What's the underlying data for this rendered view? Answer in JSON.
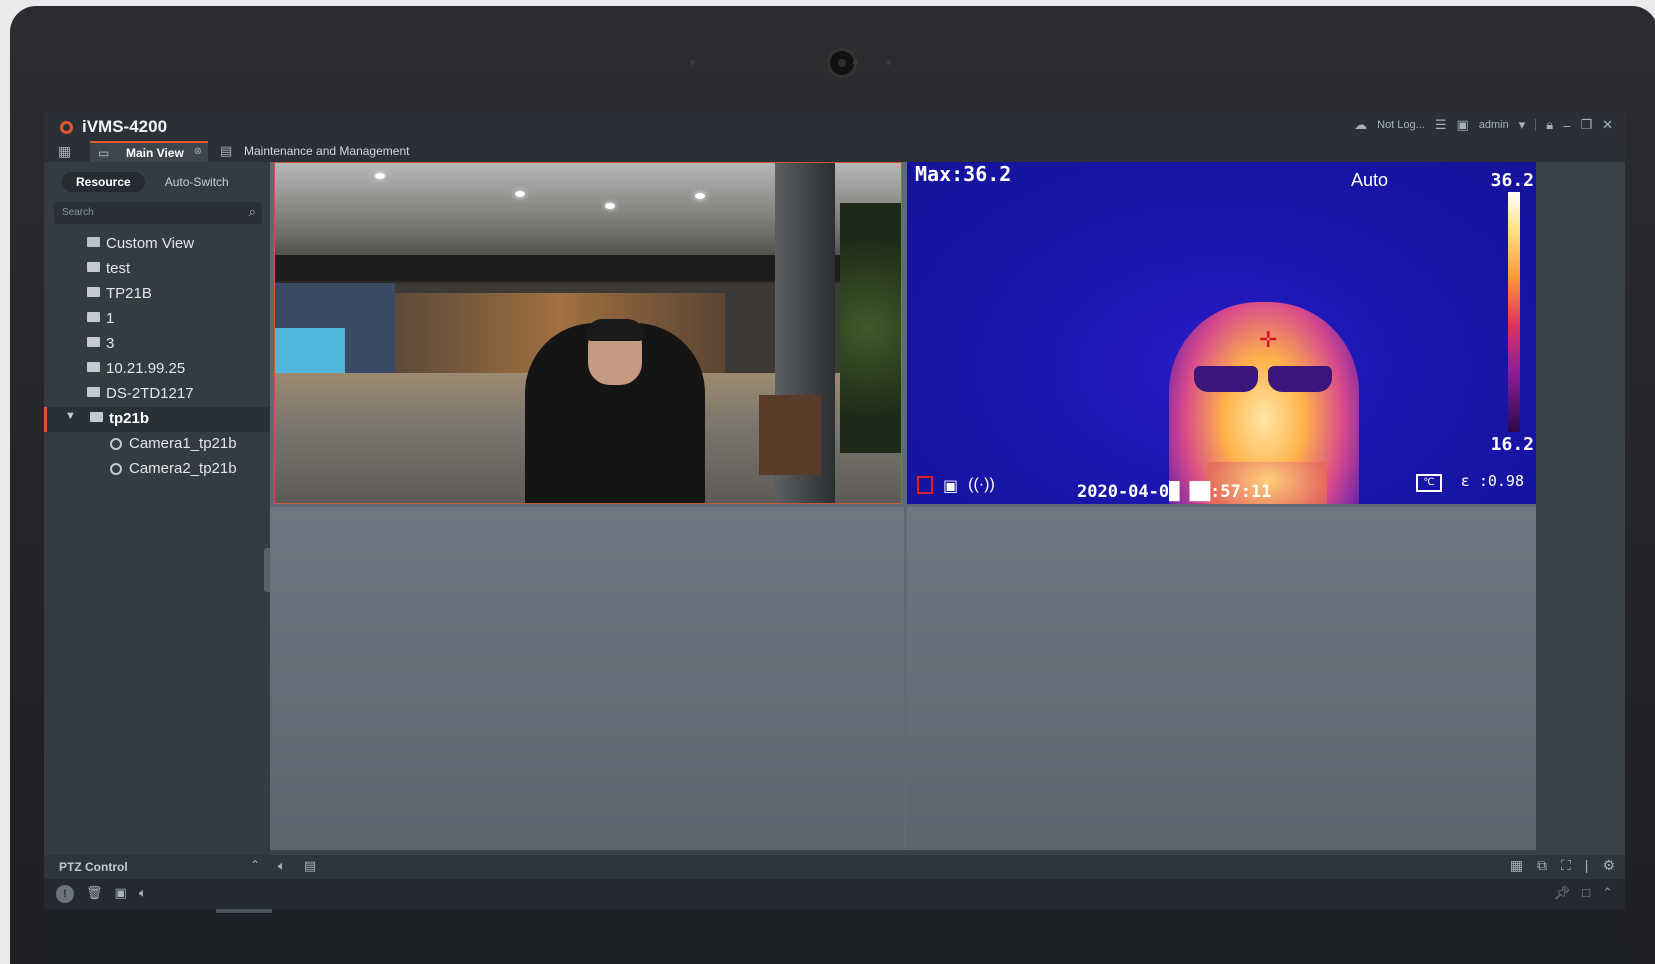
{
  "app": {
    "title": "iVMS-4200"
  },
  "titlebar": {
    "cloud_status": "Not Log...",
    "user": "admin"
  },
  "tabs": {
    "main_view": "Main View",
    "maintenance": "Maintenance and Management"
  },
  "sidebar": {
    "segments": [
      "Resource",
      "Auto-Switch"
    ],
    "search_placeholder": "Search",
    "tree": [
      "Custom View",
      "test",
      "TP21B",
      "1",
      "3",
      "10.21.99.25",
      "DS-2TD1217",
      "tp21b"
    ],
    "cameras": [
      "Camera1_tp21b",
      "Camera2_tp21b"
    ]
  },
  "thermal": {
    "max_label": "Max:36.2",
    "mode": "Auto",
    "scale_high": "36.2",
    "scale_low": "16.2",
    "timestamp": "2020-04-0█ ██:57:11",
    "emissivity": "ε :0.98",
    "unit_icon": "℃"
  },
  "bottom": {
    "ptz_label": "PTZ Control"
  },
  "icons": {
    "grid": "grid-icon",
    "camera": "camera-icon",
    "lock": "lock-icon",
    "minimize": "minimize-icon",
    "restore": "restore-icon",
    "close": "close-icon"
  },
  "colors": {
    "accent": "#e0582b",
    "background": "#3b4148",
    "panel": "#353b42"
  }
}
